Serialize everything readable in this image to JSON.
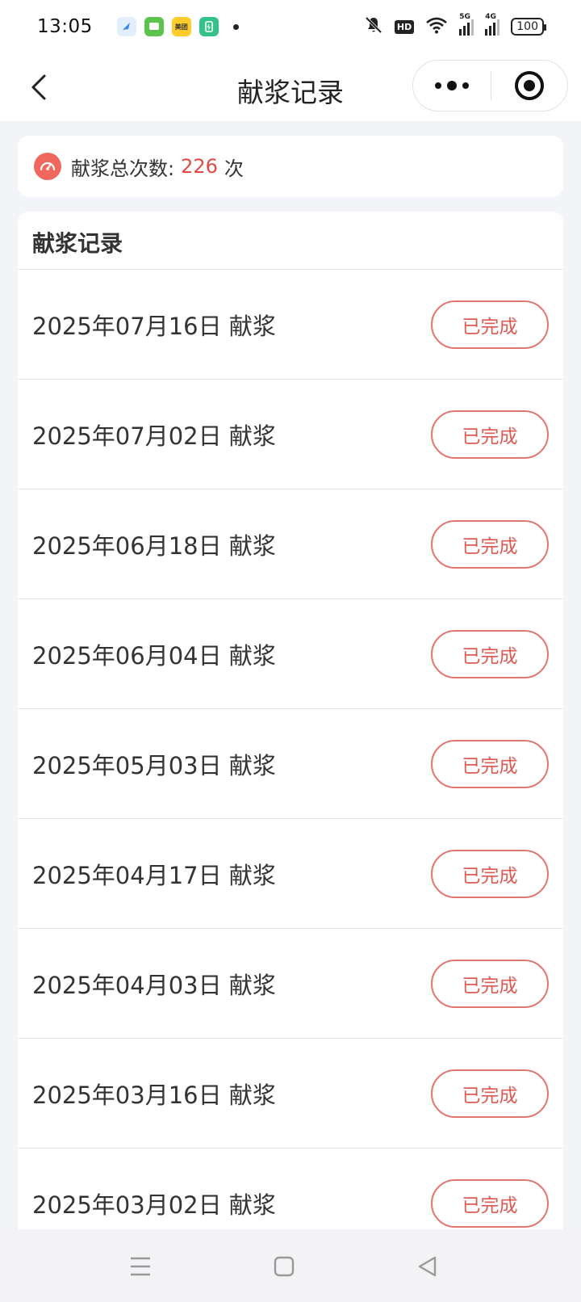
{
  "status_bar": {
    "time": "13:05",
    "notification_icons": [
      "browser-icon",
      "messages-icon",
      "meituan-icon",
      "battery-saver-icon"
    ],
    "meituan_label": "美团",
    "network_1": "5G",
    "network_2": "4G",
    "battery": "100"
  },
  "nav": {
    "title": "献浆记录"
  },
  "summary": {
    "label": "献浆总次数:",
    "value": "226",
    "unit": "次",
    "accent_color": "#e04b45"
  },
  "records": {
    "header": "献浆记录",
    "items": [
      {
        "text": "2025年07月16日 献浆",
        "status": "已完成"
      },
      {
        "text": "2025年07月02日 献浆",
        "status": "已完成"
      },
      {
        "text": "2025年06月18日 献浆",
        "status": "已完成"
      },
      {
        "text": "2025年06月04日 献浆",
        "status": "已完成"
      },
      {
        "text": "2025年05月03日 献浆",
        "status": "已完成"
      },
      {
        "text": "2025年04月17日 献浆",
        "status": "已完成"
      },
      {
        "text": "2025年04月03日 献浆",
        "status": "已完成"
      },
      {
        "text": "2025年03月16日 献浆",
        "status": "已完成"
      },
      {
        "text": "2025年03月02日 献浆",
        "status": "已完成"
      }
    ]
  },
  "system_nav": [
    "menu-icon",
    "home-icon",
    "back-triangle-icon"
  ]
}
